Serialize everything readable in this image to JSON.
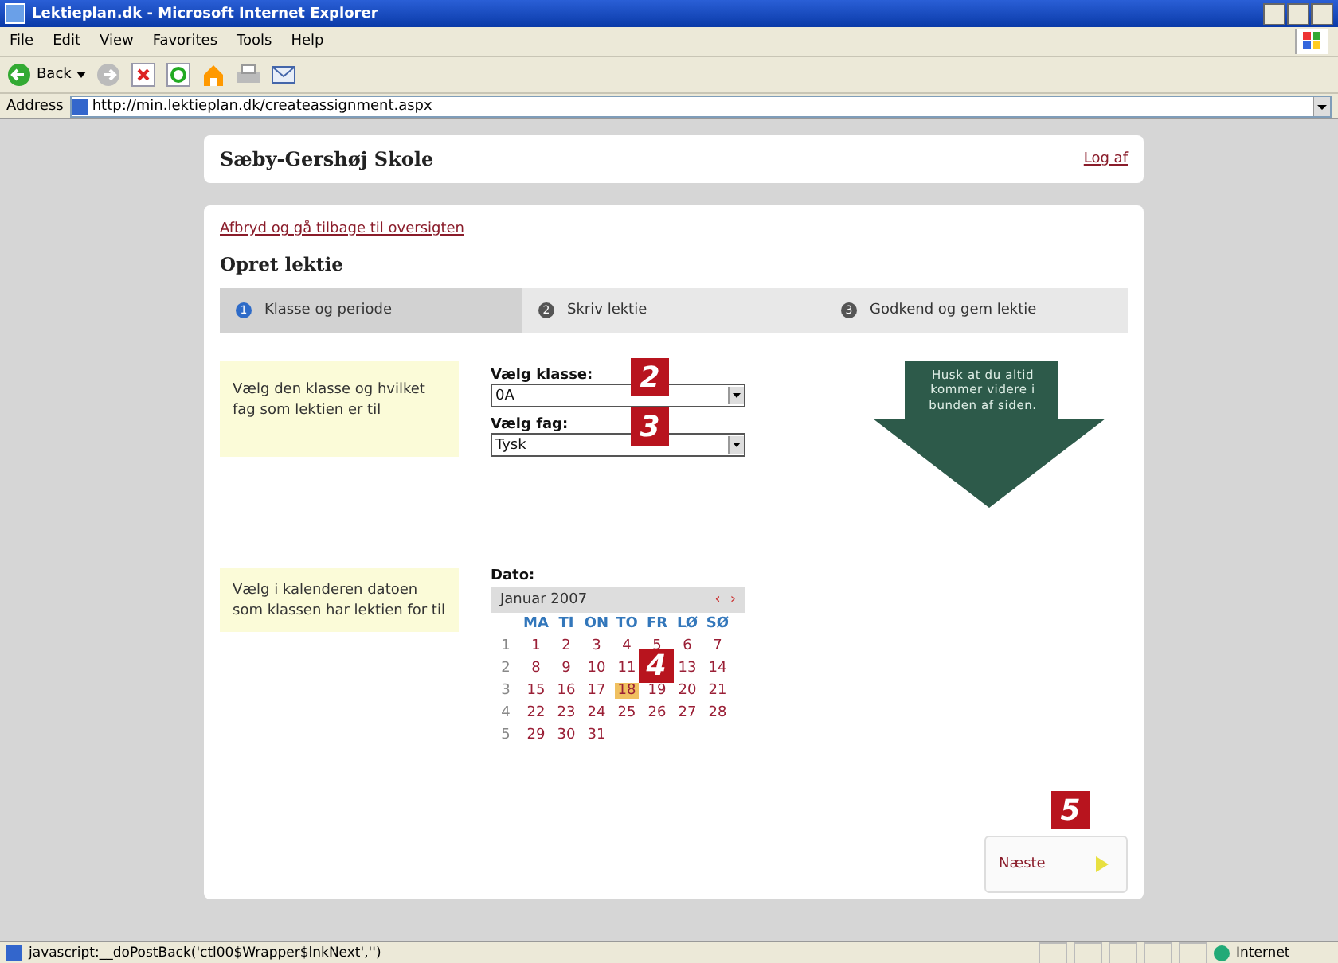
{
  "window": {
    "title": "Lektieplan.dk - Microsoft Internet Explorer"
  },
  "menu": [
    "File",
    "Edit",
    "View",
    "Favorites",
    "Tools",
    "Help"
  ],
  "toolbar": {
    "back": "Back"
  },
  "address": {
    "label": "Address",
    "value": "http://min.lektieplan.dk/createassignment.aspx"
  },
  "header": {
    "school": "Sæby-Gershøj Skole",
    "logout": "Log af"
  },
  "cancel_link": "Afbryd og gå tilbage til oversigten",
  "heading": "Opret lektie",
  "steps": [
    {
      "number": "1",
      "label": "Klasse og periode",
      "selected": true
    },
    {
      "number": "2",
      "label": "Skriv lektie",
      "selected": false
    },
    {
      "number": "3",
      "label": "Godkend og gem lektie",
      "selected": false
    }
  ],
  "class_section": {
    "hint": "Vælg den klasse og hvilket fag som lektien er til",
    "fields": [
      {
        "label": "Vælg klasse:",
        "value": "0A",
        "callout": "2"
      },
      {
        "label": "Vælg fag:",
        "value": "Tysk",
        "callout": "3"
      }
    ]
  },
  "reminder": "Husk at du altid kommer videre i bunden af siden.",
  "date_section": {
    "hint": "Vælg i kalenderen datoen som klassen har lektien for til",
    "label": "Dato:",
    "calendar": {
      "month": "Januar 2007",
      "prev": "‹",
      "next": "›",
      "callout": "4",
      "weekdays": [
        "MA",
        "TI",
        "ON",
        "TO",
        "FR",
        "LØ",
        "SØ"
      ],
      "weeks": [
        {
          "number": "1",
          "days": [
            {
              "label": "1",
              "selected": false
            },
            {
              "label": "2",
              "selected": false
            },
            {
              "label": "3",
              "selected": false
            },
            {
              "label": "4",
              "selected": false
            },
            {
              "label": "5",
              "selected": false
            },
            {
              "label": "6",
              "selected": false
            },
            {
              "label": "7",
              "selected": false
            }
          ]
        },
        {
          "number": "2",
          "days": [
            {
              "label": "8",
              "selected": false
            },
            {
              "label": "9",
              "selected": false
            },
            {
              "label": "10",
              "selected": false
            },
            {
              "label": "11",
              "selected": false
            },
            {
              "kind": "covered"
            },
            {
              "label": "13",
              "selected": false
            },
            {
              "label": "14",
              "selected": false
            }
          ]
        },
        {
          "number": "3",
          "days": [
            {
              "label": "15",
              "selected": false
            },
            {
              "label": "16",
              "selected": false
            },
            {
              "label": "17",
              "selected": false
            },
            {
              "label": "18",
              "selected": true
            },
            {
              "label": "19",
              "selected": false
            },
            {
              "label": "20",
              "selected": false
            },
            {
              "label": "21",
              "selected": false
            }
          ]
        },
        {
          "number": "4",
          "days": [
            {
              "label": "22",
              "selected": false
            },
            {
              "label": "23",
              "selected": false
            },
            {
              "label": "24",
              "selected": false
            },
            {
              "label": "25",
              "selected": false
            },
            {
              "label": "26",
              "selected": false
            },
            {
              "label": "27",
              "selected": false
            },
            {
              "label": "28",
              "selected": false
            }
          ]
        },
        {
          "number": "5",
          "days": [
            {
              "label": "29",
              "selected": false
            },
            {
              "label": "30",
              "selected": false
            },
            {
              "label": "31",
              "selected": false
            }
          ]
        }
      ]
    }
  },
  "next_button": {
    "label": "Næste",
    "callout": "5"
  },
  "status_bar": {
    "text": "javascript:__doPostBack('ctl00$Wrapper$lnkNext','')",
    "zone": "Internet"
  }
}
